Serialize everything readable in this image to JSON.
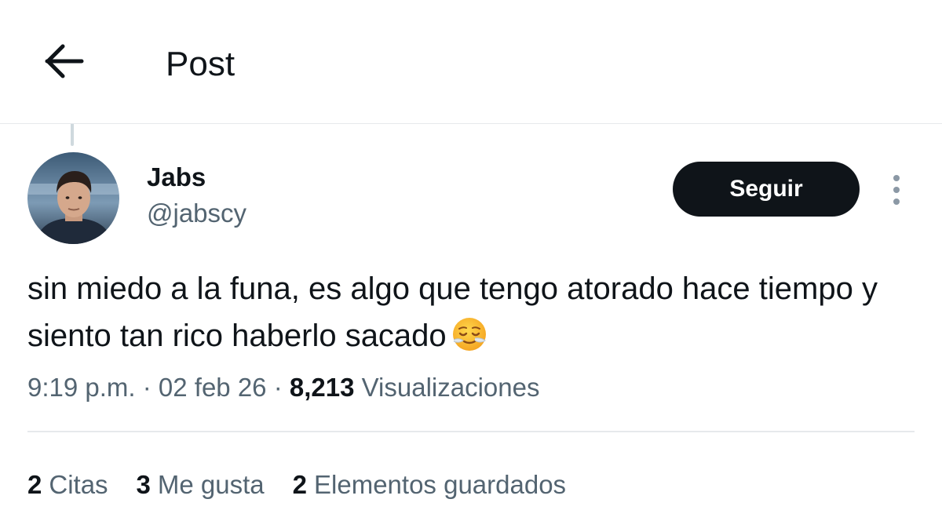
{
  "header": {
    "title": "Post",
    "back_icon": "arrow-left-icon"
  },
  "author": {
    "name": "Jabs",
    "handle": "@jabscy",
    "avatar": "profile-photo"
  },
  "follow_button": {
    "label": "Seguir"
  },
  "more_icon": "vertical-ellipsis-icon",
  "post": {
    "text": "sin miedo a la funa, es algo que tengo atorado hace tiempo y siento tan rico haberlo sacado",
    "emoji": "relieved-face-emoji"
  },
  "meta": {
    "time": "9:19 p.m.",
    "sep1": " · ",
    "date": "02 feb 26",
    "sep2": " · ",
    "views_count": "8,213",
    "views_label": " Visualizaciones"
  },
  "stats": [
    {
      "count": "2",
      "label": "Citas"
    },
    {
      "count": "3",
      "label": "Me gusta"
    },
    {
      "count": "2",
      "label": "Elementos guardados"
    }
  ],
  "colors": {
    "text_primary": "#0f1419",
    "text_secondary": "#536471",
    "divider": "#e6e9ec",
    "follow_bg": "#0f1419",
    "follow_text": "#ffffff"
  }
}
